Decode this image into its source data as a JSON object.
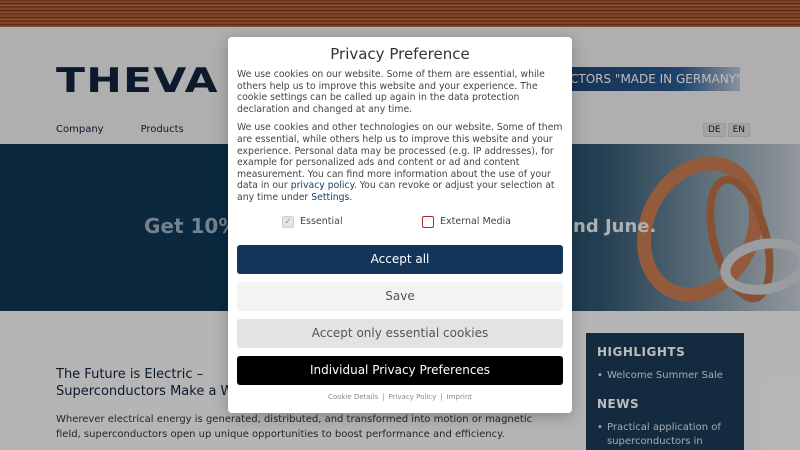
{
  "site": {
    "logo": "THEVA",
    "tagline": "CTORS \"MADE IN GERMANY\"",
    "nav": [
      "Company",
      "Products"
    ],
    "languages": [
      "DE",
      "EN"
    ]
  },
  "hero": {
    "text_left": "Get 10%",
    "text_right": "nd June."
  },
  "content": {
    "headline_line1": "The Future is Electric –",
    "headline_line2": "Superconductors Make a Wo",
    "body": "Wherever electrical energy is generated, distributed, and transformed into motion or magnetic field, superconductors open up unique opportunities to boost performance and efficiency."
  },
  "sidebar": {
    "highlights_title": "HIGHLIGHTS",
    "highlights": [
      "Welcome Summer Sale"
    ],
    "news_title": "NEWS",
    "news": [
      "Practical application of superconductors in"
    ]
  },
  "modal": {
    "title": "Privacy Preference",
    "paragraph1": "We use cookies on our website. Some of them are essential, while others help us to improve this website and your experience. The cookie settings can be called up again in the data protection declaration and changed at any time.",
    "paragraph2_part1": "We use cookies and other technologies on our website. Some of them are essential, while others help us to improve this website and your experience. Personal data may be processed (e.g. IP addresses), for example for personalized ads and content or ad and content measurement. You can find more information about the use of your data in our ",
    "privacy_link": "privacy policy",
    "paragraph2_part2": ". You can revoke or adjust your selection at any time under ",
    "settings_link": "Settings",
    "paragraph2_end": ".",
    "check_essential": "Essential",
    "check_external": "External Media",
    "btn_accept_all": "Accept all",
    "btn_save": "Save",
    "btn_essential_only": "Accept only essential cookies",
    "btn_individual": "Individual Privacy Preferences",
    "link_cookie_details": "Cookie Details",
    "link_privacy_policy": "Privacy Policy",
    "link_imprint": "Imprint"
  },
  "colors": {
    "primary_button": "#13355a",
    "external_media_checkbox": "#b5202a"
  }
}
